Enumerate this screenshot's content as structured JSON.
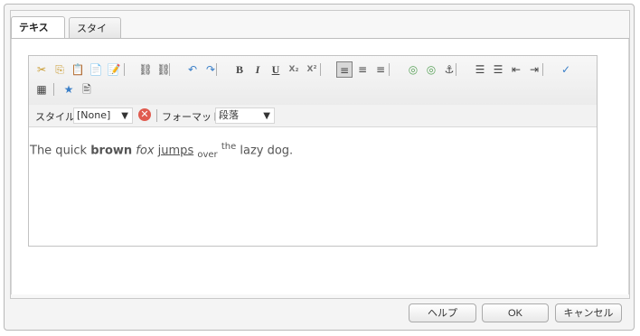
{
  "tabs": [
    {
      "label": "テキスト",
      "active": true
    },
    {
      "label": "スタイル",
      "active": false
    }
  ],
  "toolbar": {
    "row1": [
      {
        "name": "cut-icon",
        "glyph": "✂"
      },
      {
        "name": "copy-icon",
        "glyph": "⎘"
      },
      {
        "name": "paste-icon",
        "glyph": "📋"
      },
      {
        "name": "paste-text-icon",
        "glyph": "📄"
      },
      {
        "name": "paste-word-icon",
        "glyph": "📝"
      },
      {
        "sep": true
      },
      {
        "name": "link-icon",
        "glyph": "⛓"
      },
      {
        "name": "unlink-icon",
        "glyph": "⛓"
      },
      {
        "sep": true
      },
      {
        "name": "undo-icon",
        "glyph": "↶"
      },
      {
        "name": "redo-icon",
        "glyph": "↷"
      },
      {
        "sep": true
      },
      {
        "name": "bold-icon",
        "glyph": "B"
      },
      {
        "name": "italic-icon",
        "glyph": "I"
      },
      {
        "name": "underline-icon",
        "glyph": "U"
      },
      {
        "name": "subscript-icon",
        "glyph": "X₂"
      },
      {
        "name": "superscript-icon",
        "glyph": "X²"
      },
      {
        "sep": true
      },
      {
        "name": "align-left-icon",
        "glyph": "≡",
        "pressed": true
      },
      {
        "name": "align-center-icon",
        "glyph": "≡"
      },
      {
        "name": "align-right-icon",
        "glyph": "≡"
      },
      {
        "sep": true
      },
      {
        "name": "link-green-icon",
        "glyph": "◎"
      },
      {
        "name": "unlink-green-icon",
        "glyph": "◎"
      },
      {
        "name": "anchor-icon",
        "glyph": "⚓"
      },
      {
        "sep": true
      },
      {
        "name": "bulleted-list-icon",
        "glyph": "☰"
      },
      {
        "name": "numbered-list-icon",
        "glyph": "☰"
      },
      {
        "name": "outdent-icon",
        "glyph": "⇤"
      },
      {
        "name": "indent-icon",
        "glyph": "⇥"
      },
      {
        "sep": true
      },
      {
        "name": "spellcheck-icon",
        "glyph": "✓"
      }
    ],
    "row2": [
      {
        "name": "table-icon",
        "glyph": "▦"
      },
      {
        "sep": true
      },
      {
        "name": "special-char-icon",
        "glyph": "★"
      },
      {
        "name": "find-replace-icon",
        "glyph": "🖹"
      }
    ]
  },
  "stylebar": {
    "style_label": "スタイル",
    "style_value": "[None]",
    "format_label": "フォーマット",
    "format_value": "段落"
  },
  "content": {
    "w1": "The quick",
    "w2": "brown",
    "w3": "fox",
    "w4": "jumps",
    "w5": "over",
    "w6": "the",
    "w7": "lazy dog."
  },
  "footer": {
    "help": "ヘルプ",
    "ok": "OK",
    "cancel": "キャンセル"
  }
}
